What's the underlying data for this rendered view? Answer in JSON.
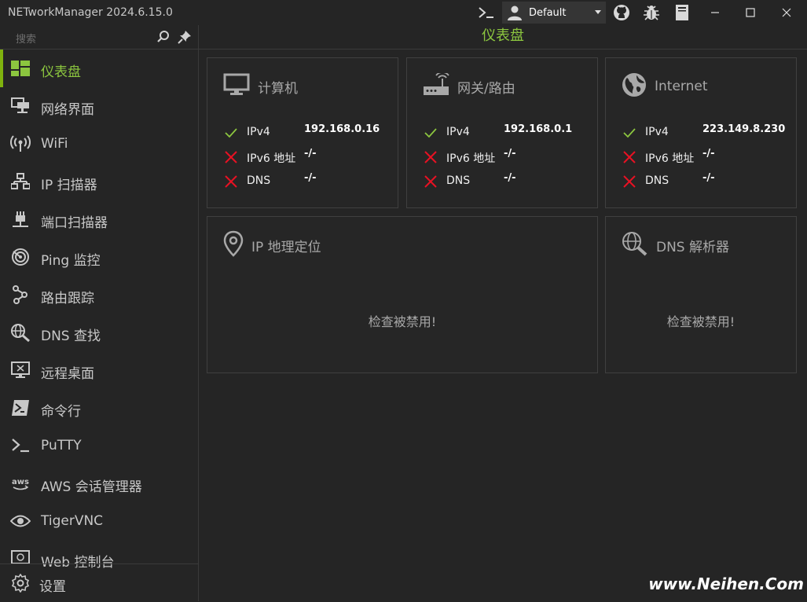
{
  "app": {
    "title": "NETworkManager 2024.6.15.0"
  },
  "toolbar": {
    "profile": "Default"
  },
  "sidebar": {
    "search_placeholder": "搜索",
    "items": [
      {
        "label": "仪表盘",
        "icon": "dashboard-icon",
        "active": true
      },
      {
        "label": "网络界面",
        "icon": "network-interface-icon"
      },
      {
        "label": "WiFi",
        "icon": "wifi-icon"
      },
      {
        "label": "IP 扫描器",
        "icon": "ip-scanner-icon"
      },
      {
        "label": "端口扫描器",
        "icon": "port-scanner-icon"
      },
      {
        "label": "Ping 监控",
        "icon": "ping-monitor-icon"
      },
      {
        "label": "路由跟踪",
        "icon": "traceroute-icon"
      },
      {
        "label": "DNS 查找",
        "icon": "dns-lookup-icon"
      },
      {
        "label": "远程桌面",
        "icon": "remote-desktop-icon"
      },
      {
        "label": "命令行",
        "icon": "powershell-icon"
      },
      {
        "label": "PuTTY",
        "icon": "putty-icon"
      },
      {
        "label": "AWS 会话管理器",
        "icon": "aws-icon"
      },
      {
        "label": "TigerVNC",
        "icon": "eye-icon"
      },
      {
        "label": "Web 控制台",
        "icon": "web-console-icon"
      }
    ],
    "settings": "设置"
  },
  "main": {
    "title": "仪表盘",
    "computer": {
      "title": "计算机",
      "rows": [
        {
          "key": "IPv4",
          "value": "192.168.0.16",
          "ok": true
        },
        {
          "key": "IPv6 地址",
          "value": "-/-",
          "ok": false
        },
        {
          "key": "DNS",
          "value": "-/-",
          "ok": false
        }
      ]
    },
    "gateway": {
      "title": "网关/路由",
      "rows": [
        {
          "key": "IPv4",
          "value": "192.168.0.1",
          "ok": true
        },
        {
          "key": "IPv6 地址",
          "value": "-/-",
          "ok": false
        },
        {
          "key": "DNS",
          "value": "-/-",
          "ok": false
        }
      ]
    },
    "internet": {
      "title": "Internet",
      "rows": [
        {
          "key": "IPv4",
          "value": "223.149.8.230",
          "ok": true
        },
        {
          "key": "IPv6 地址",
          "value": "-/-",
          "ok": false
        },
        {
          "key": "DNS",
          "value": "-/-",
          "ok": false
        }
      ]
    },
    "geolocation": {
      "title": "IP 地理定位",
      "message": "检查被禁用!"
    },
    "dns_resolver": {
      "title": "DNS 解析器",
      "message": "检查被禁用!"
    }
  },
  "watermark": "www.Neihen.Com",
  "colors": {
    "accent": "#8cc63f",
    "ok": "#8cc63f",
    "error": "#e81123"
  }
}
